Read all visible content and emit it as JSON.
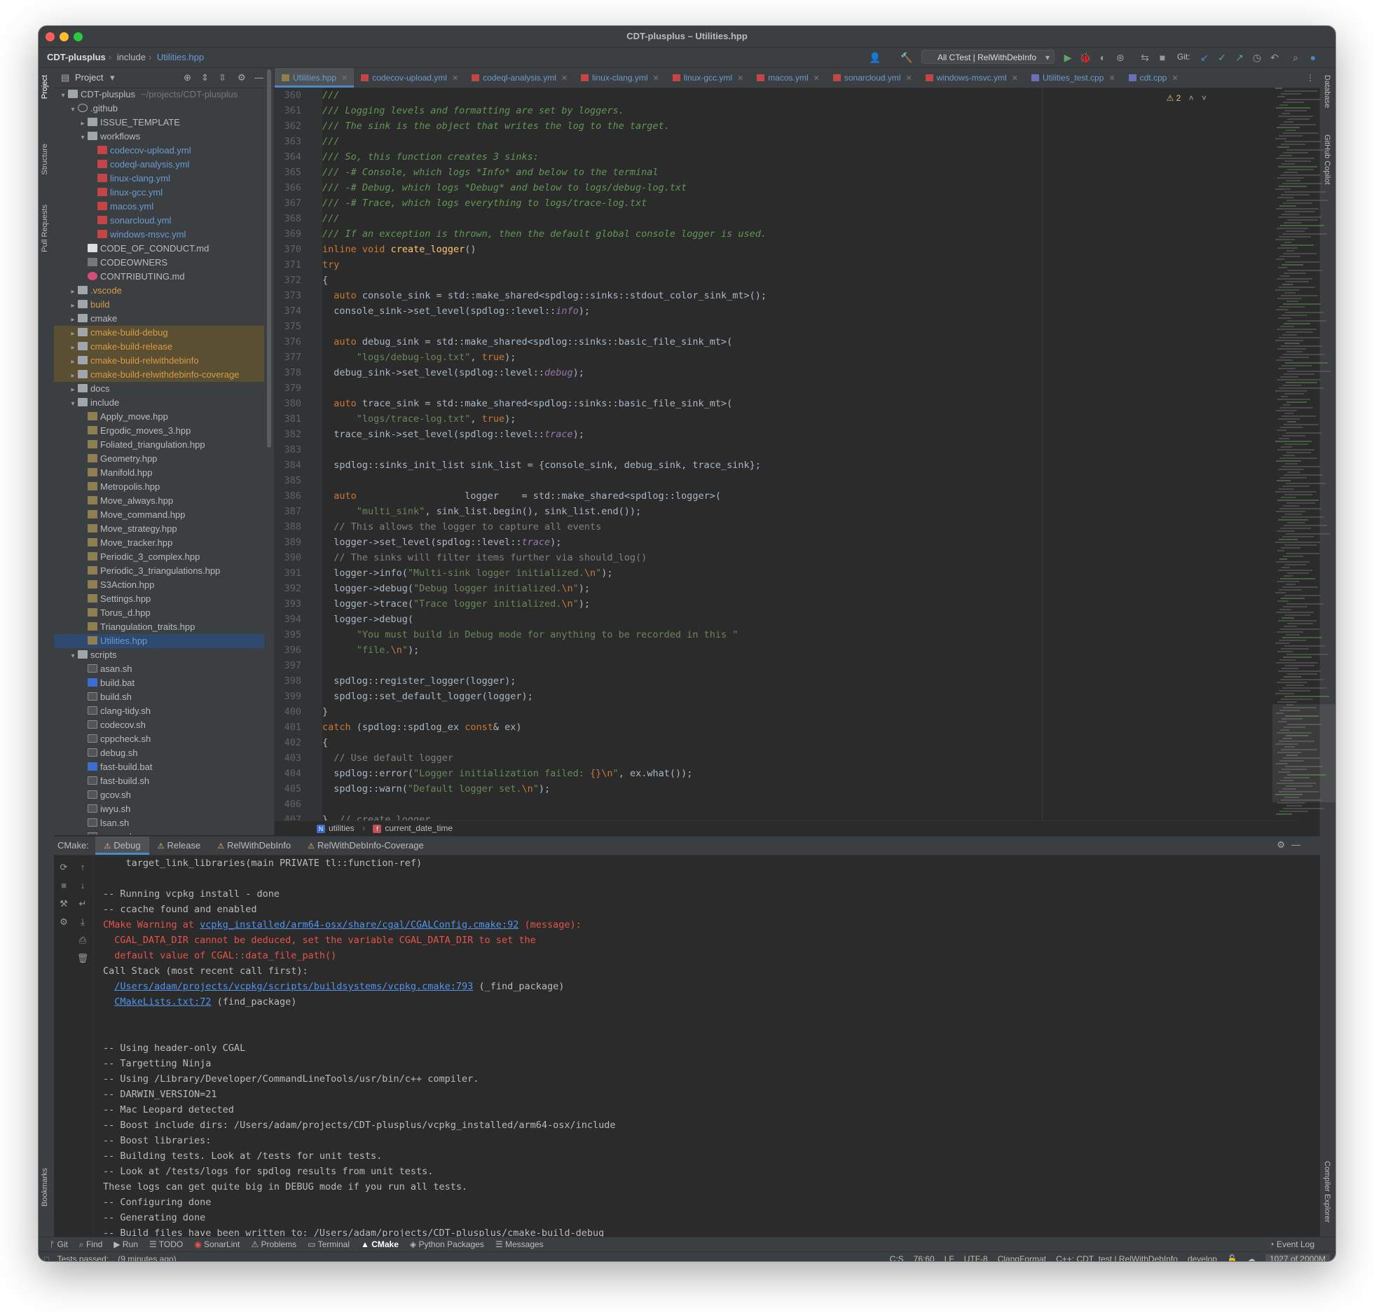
{
  "window": {
    "title": "CDT-plusplus – Utilities.hpp"
  },
  "navbar": {
    "crumbs": [
      "CDT-plusplus",
      "include",
      "Utilities.hpp"
    ],
    "run_config": "All CTest | RelWithDebInfo",
    "git_label": "Git:"
  },
  "left_strip": {
    "project": "Project",
    "structure": "Structure",
    "pull_requests": "Pull Requests",
    "bookmarks": "Bookmarks"
  },
  "right_strip": {
    "database": "Database",
    "copilot": "GitHub Copilot",
    "compiler_explorer": "Compiler Explorer"
  },
  "project": {
    "header": "Project",
    "tree": [
      {
        "name": "CDT-plusplus",
        "extra": "~/projects/CDT-plusplus",
        "depth": 0,
        "arrow": "v",
        "icon": "folder"
      },
      {
        "name": ".github",
        "depth": 1,
        "arrow": "v",
        "icon": "gh"
      },
      {
        "name": "ISSUE_TEMPLATE",
        "depth": 2,
        "arrow": ">",
        "icon": "folder"
      },
      {
        "name": "workflows",
        "depth": 2,
        "arrow": "v",
        "icon": "folder"
      },
      {
        "name": "codecov-upload.yml",
        "depth": 3,
        "icon": "yml",
        "style": "blue"
      },
      {
        "name": "codeql-analysis.yml",
        "depth": 3,
        "icon": "yml",
        "style": "blue"
      },
      {
        "name": "linux-clang.yml",
        "depth": 3,
        "icon": "yml",
        "style": "blue"
      },
      {
        "name": "linux-gcc.yml",
        "depth": 3,
        "icon": "yml",
        "style": "blue"
      },
      {
        "name": "macos.yml",
        "depth": 3,
        "icon": "yml",
        "style": "blue"
      },
      {
        "name": "sonarcloud.yml",
        "depth": 3,
        "icon": "yml",
        "style": "blue"
      },
      {
        "name": "windows-msvc.yml",
        "depth": 3,
        "icon": "yml",
        "style": "blue"
      },
      {
        "name": "CODE_OF_CONDUCT.md",
        "depth": 2,
        "icon": "md"
      },
      {
        "name": "CODEOWNERS",
        "depth": 2,
        "icon": "co"
      },
      {
        "name": "CONTRIBUTING.md",
        "depth": 2,
        "icon": "heart"
      },
      {
        "name": ".vscode",
        "depth": 1,
        "arrow": ">",
        "icon": "folder",
        "style": "orange"
      },
      {
        "name": "build",
        "depth": 1,
        "arrow": ">",
        "icon": "folder",
        "style": "orange"
      },
      {
        "name": "cmake",
        "depth": 1,
        "arrow": ">",
        "icon": "folder"
      },
      {
        "name": "cmake-build-debug",
        "depth": 1,
        "arrow": ">",
        "icon": "folder",
        "style": "orange",
        "hl": true
      },
      {
        "name": "cmake-build-release",
        "depth": 1,
        "arrow": ">",
        "icon": "folder",
        "style": "orange",
        "hl": true
      },
      {
        "name": "cmake-build-relwithdebinfo",
        "depth": 1,
        "arrow": ">",
        "icon": "folder",
        "style": "orange",
        "hl": true
      },
      {
        "name": "cmake-build-relwithdebinfo-coverage",
        "depth": 1,
        "arrow": ">",
        "icon": "folder",
        "style": "orange",
        "hl": true
      },
      {
        "name": "docs",
        "depth": 1,
        "arrow": ">",
        "icon": "folder"
      },
      {
        "name": "include",
        "depth": 1,
        "arrow": "v",
        "icon": "folder"
      },
      {
        "name": "Apply_move.hpp",
        "depth": 2,
        "icon": "hpp"
      },
      {
        "name": "Ergodic_moves_3.hpp",
        "depth": 2,
        "icon": "hpp"
      },
      {
        "name": "Foliated_triangulation.hpp",
        "depth": 2,
        "icon": "hpp"
      },
      {
        "name": "Geometry.hpp",
        "depth": 2,
        "icon": "hpp"
      },
      {
        "name": "Manifold.hpp",
        "depth": 2,
        "icon": "hpp"
      },
      {
        "name": "Metropolis.hpp",
        "depth": 2,
        "icon": "hpp"
      },
      {
        "name": "Move_always.hpp",
        "depth": 2,
        "icon": "hpp"
      },
      {
        "name": "Move_command.hpp",
        "depth": 2,
        "icon": "hpp"
      },
      {
        "name": "Move_strategy.hpp",
        "depth": 2,
        "icon": "hpp"
      },
      {
        "name": "Move_tracker.hpp",
        "depth": 2,
        "icon": "hpp"
      },
      {
        "name": "Periodic_3_complex.hpp",
        "depth": 2,
        "icon": "hpp"
      },
      {
        "name": "Periodic_3_triangulations.hpp",
        "depth": 2,
        "icon": "hpp"
      },
      {
        "name": "S3Action.hpp",
        "depth": 2,
        "icon": "hpp"
      },
      {
        "name": "Settings.hpp",
        "depth": 2,
        "icon": "hpp"
      },
      {
        "name": "Torus_d.hpp",
        "depth": 2,
        "icon": "hpp"
      },
      {
        "name": "Triangulation_traits.hpp",
        "depth": 2,
        "icon": "hpp"
      },
      {
        "name": "Utilities.hpp",
        "depth": 2,
        "icon": "hpp",
        "style": "blue",
        "sel": true
      },
      {
        "name": "scripts",
        "depth": 1,
        "arrow": "v",
        "icon": "folder"
      },
      {
        "name": "asan.sh",
        "depth": 2,
        "icon": "sh"
      },
      {
        "name": "build.bat",
        "depth": 2,
        "icon": "bat"
      },
      {
        "name": "build.sh",
        "depth": 2,
        "icon": "sh"
      },
      {
        "name": "clang-tidy.sh",
        "depth": 2,
        "icon": "sh"
      },
      {
        "name": "codecov.sh",
        "depth": 2,
        "icon": "sh"
      },
      {
        "name": "cppcheck.sh",
        "depth": 2,
        "icon": "sh"
      },
      {
        "name": "debug.sh",
        "depth": 2,
        "icon": "sh"
      },
      {
        "name": "fast-build.bat",
        "depth": 2,
        "icon": "bat"
      },
      {
        "name": "fast-build.sh",
        "depth": 2,
        "icon": "sh"
      },
      {
        "name": "gcov.sh",
        "depth": 2,
        "icon": "sh"
      },
      {
        "name": "iwyu.sh",
        "depth": 2,
        "icon": "sh"
      },
      {
        "name": "lsan.sh",
        "depth": 2,
        "icon": "sh"
      },
      {
        "name": "msan.sh",
        "depth": 2,
        "icon": "sh"
      }
    ]
  },
  "tabs": [
    {
      "label": "Utilities.hpp",
      "active": true
    },
    {
      "label": "codecov-upload.yml"
    },
    {
      "label": "codeql-analysis.yml"
    },
    {
      "label": "linux-clang.yml"
    },
    {
      "label": "linux-gcc.yml"
    },
    {
      "label": "macos.yml"
    },
    {
      "label": "sonarcloud.yml"
    },
    {
      "label": "windows-msvc.yml"
    },
    {
      "label": "Utilities_test.cpp"
    },
    {
      "label": "cdt.cpp"
    }
  ],
  "editor": {
    "warning_count": "2",
    "lines": [
      {
        "n": "360",
        "t": "///"
      },
      {
        "n": "361",
        "t": "/// Logging levels and formatting are set by loggers."
      },
      {
        "n": "362",
        "t": "/// The sink is the object that writes the log to the target."
      },
      {
        "n": "363",
        "t": "///"
      },
      {
        "n": "364",
        "t": "/// So, this function creates 3 sinks:"
      },
      {
        "n": "365",
        "t": "/// -# Console, which logs *Info* and below to the terminal"
      },
      {
        "n": "366",
        "t": "/// -# Debug, which logs *Debug* and below to logs/debug-log.txt"
      },
      {
        "n": "367",
        "t": "/// -# Trace, which logs everything to logs/trace-log.txt"
      },
      {
        "n": "368",
        "t": "///"
      },
      {
        "n": "369",
        "t": "/// If an exception is thrown, then the default global console logger is used."
      },
      {
        "n": "370",
        "t": "inline void create_logger()"
      },
      {
        "n": "371",
        "t": "try"
      },
      {
        "n": "372",
        "t": "{"
      },
      {
        "n": "373",
        "t": "  auto console_sink = std::make_shared<spdlog::sinks::stdout_color_sink_mt>();"
      },
      {
        "n": "374",
        "t": "  console_sink->set_level(spdlog::level::info);"
      },
      {
        "n": "375",
        "t": ""
      },
      {
        "n": "376",
        "t": "  auto debug_sink = std::make_shared<spdlog::sinks::basic_file_sink_mt>("
      },
      {
        "n": "377",
        "t": "      \"logs/debug-log.txt\", true);"
      },
      {
        "n": "378",
        "t": "  debug_sink->set_level(spdlog::level::debug);"
      },
      {
        "n": "379",
        "t": ""
      },
      {
        "n": "380",
        "t": "  auto trace_sink = std::make_shared<spdlog::sinks::basic_file_sink_mt>("
      },
      {
        "n": "381",
        "t": "      \"logs/trace-log.txt\", true);"
      },
      {
        "n": "382",
        "t": "  trace_sink->set_level(spdlog::level::trace);"
      },
      {
        "n": "383",
        "t": ""
      },
      {
        "n": "384",
        "t": "  spdlog::sinks_init_list sink_list = {console_sink, debug_sink, trace_sink};"
      },
      {
        "n": "385",
        "t": ""
      },
      {
        "n": "386",
        "t": "  auto                   logger    = std::make_shared<spdlog::logger>("
      },
      {
        "n": "387",
        "t": "      \"multi_sink\", sink_list.begin(), sink_list.end());"
      },
      {
        "n": "388",
        "t": "  // This allows the logger to capture all events"
      },
      {
        "n": "389",
        "t": "  logger->set_level(spdlog::level::trace);"
      },
      {
        "n": "390",
        "t": "  // The sinks will filter items further via should_log()"
      },
      {
        "n": "391",
        "t": "  logger->info(\"Multi-sink logger initialized.\\n\");"
      },
      {
        "n": "392",
        "t": "  logger->debug(\"Debug logger initialized.\\n\");"
      },
      {
        "n": "393",
        "t": "  logger->trace(\"Trace logger initialized.\\n\");"
      },
      {
        "n": "394",
        "t": "  logger->debug("
      },
      {
        "n": "395",
        "t": "      \"You must build in Debug mode for anything to be recorded in this \""
      },
      {
        "n": "396",
        "t": "      \"file.\\n\");"
      },
      {
        "n": "397",
        "t": ""
      },
      {
        "n": "398",
        "t": "  spdlog::register_logger(logger);"
      },
      {
        "n": "399",
        "t": "  spdlog::set_default_logger(logger);"
      },
      {
        "n": "400",
        "t": "}"
      },
      {
        "n": "401",
        "t": "catch (spdlog::spdlog_ex const& ex)"
      },
      {
        "n": "402",
        "t": "{"
      },
      {
        "n": "403",
        "t": "  // Use default logger"
      },
      {
        "n": "404",
        "t": "  spdlog::error(\"Logger initialization failed: {}\\n\", ex.what());"
      },
      {
        "n": "405",
        "t": "  spdlog::warn(\"Default logger set.\\n\");"
      },
      {
        "n": "406",
        "t": ""
      },
      {
        "n": "407",
        "t": "}  // create_logger"
      }
    ],
    "breadcrumb": {
      "namespace": "utilities",
      "function": "current_date_time"
    }
  },
  "cmake": {
    "label": "CMake:",
    "tabs": [
      "Debug",
      "Release",
      "RelWithDebInfo",
      "RelWithDebInfo-Coverage"
    ],
    "output": [
      {
        "t": "    target_link_libraries(main PRIVATE tl::function-ref)"
      },
      {
        "t": ""
      },
      {
        "t": "-- Running vcpkg install - done"
      },
      {
        "t": "-- ccache found and enabled"
      },
      {
        "t": "CMake Warning at ",
        "link": "vcpkg_installed/arm64-osx/share/cgal/CGALConfig.cmake:92",
        "after": " (message):",
        "red": true
      },
      {
        "t": "  CGAL_DATA_DIR cannot be deduced, set the variable CGAL_DATA_DIR to set the",
        "red": true
      },
      {
        "t": "  default value of CGAL::data_file_path()",
        "red": true
      },
      {
        "t": "Call Stack (most recent call first):"
      },
      {
        "t": "  ",
        "link": "/Users/adam/projects/vcpkg/scripts/buildsystems/vcpkg.cmake:793",
        "after": " (_find_package)"
      },
      {
        "t": "  ",
        "link": "CMakeLists.txt:72",
        "after": " (find_package)"
      },
      {
        "t": ""
      },
      {
        "t": ""
      },
      {
        "t": "-- Using header-only CGAL"
      },
      {
        "t": "-- Targetting Ninja"
      },
      {
        "t": "-- Using /Library/Developer/CommandLineTools/usr/bin/c++ compiler."
      },
      {
        "t": "-- DARWIN_VERSION=21"
      },
      {
        "t": "-- Mac Leopard detected"
      },
      {
        "t": "-- Boost include dirs: /Users/adam/projects/CDT-plusplus/vcpkg_installed/arm64-osx/include"
      },
      {
        "t": "-- Boost libraries:"
      },
      {
        "t": "-- Building tests. Look at /tests for unit tests."
      },
      {
        "t": "-- Look at /tests/logs for spdlog results from unit tests."
      },
      {
        "t": "These logs can get quite big in DEBUG mode if you run all tests."
      },
      {
        "t": "-- Configuring done"
      },
      {
        "t": "-- Generating done"
      },
      {
        "t": "-- Build files have been written to: /Users/adam/projects/CDT-plusplus/cmake-build-debug"
      }
    ]
  },
  "toolwindows": [
    "Git",
    "Find",
    "Run",
    "TODO",
    "SonarLint",
    "Problems",
    "Terminal",
    "CMake",
    "Python Packages",
    "Messages"
  ],
  "event_log": "Event Log",
  "status": {
    "left": "Tests passed:... (9 minutes ago)",
    "encoding_items": [
      "C:S",
      "76:60",
      "LF",
      "UTF-8",
      "ClangFormat",
      "C++: CDT_test | RelWithDebInfo",
      "develop"
    ],
    "memory": "1027 of 2000M"
  },
  "colors": {
    "keyword": "#cc7832",
    "comment": "#629755",
    "line_comment": "#808080",
    "string": "#6a8759",
    "function": "#ffc66d",
    "enum": "#9876aa"
  }
}
